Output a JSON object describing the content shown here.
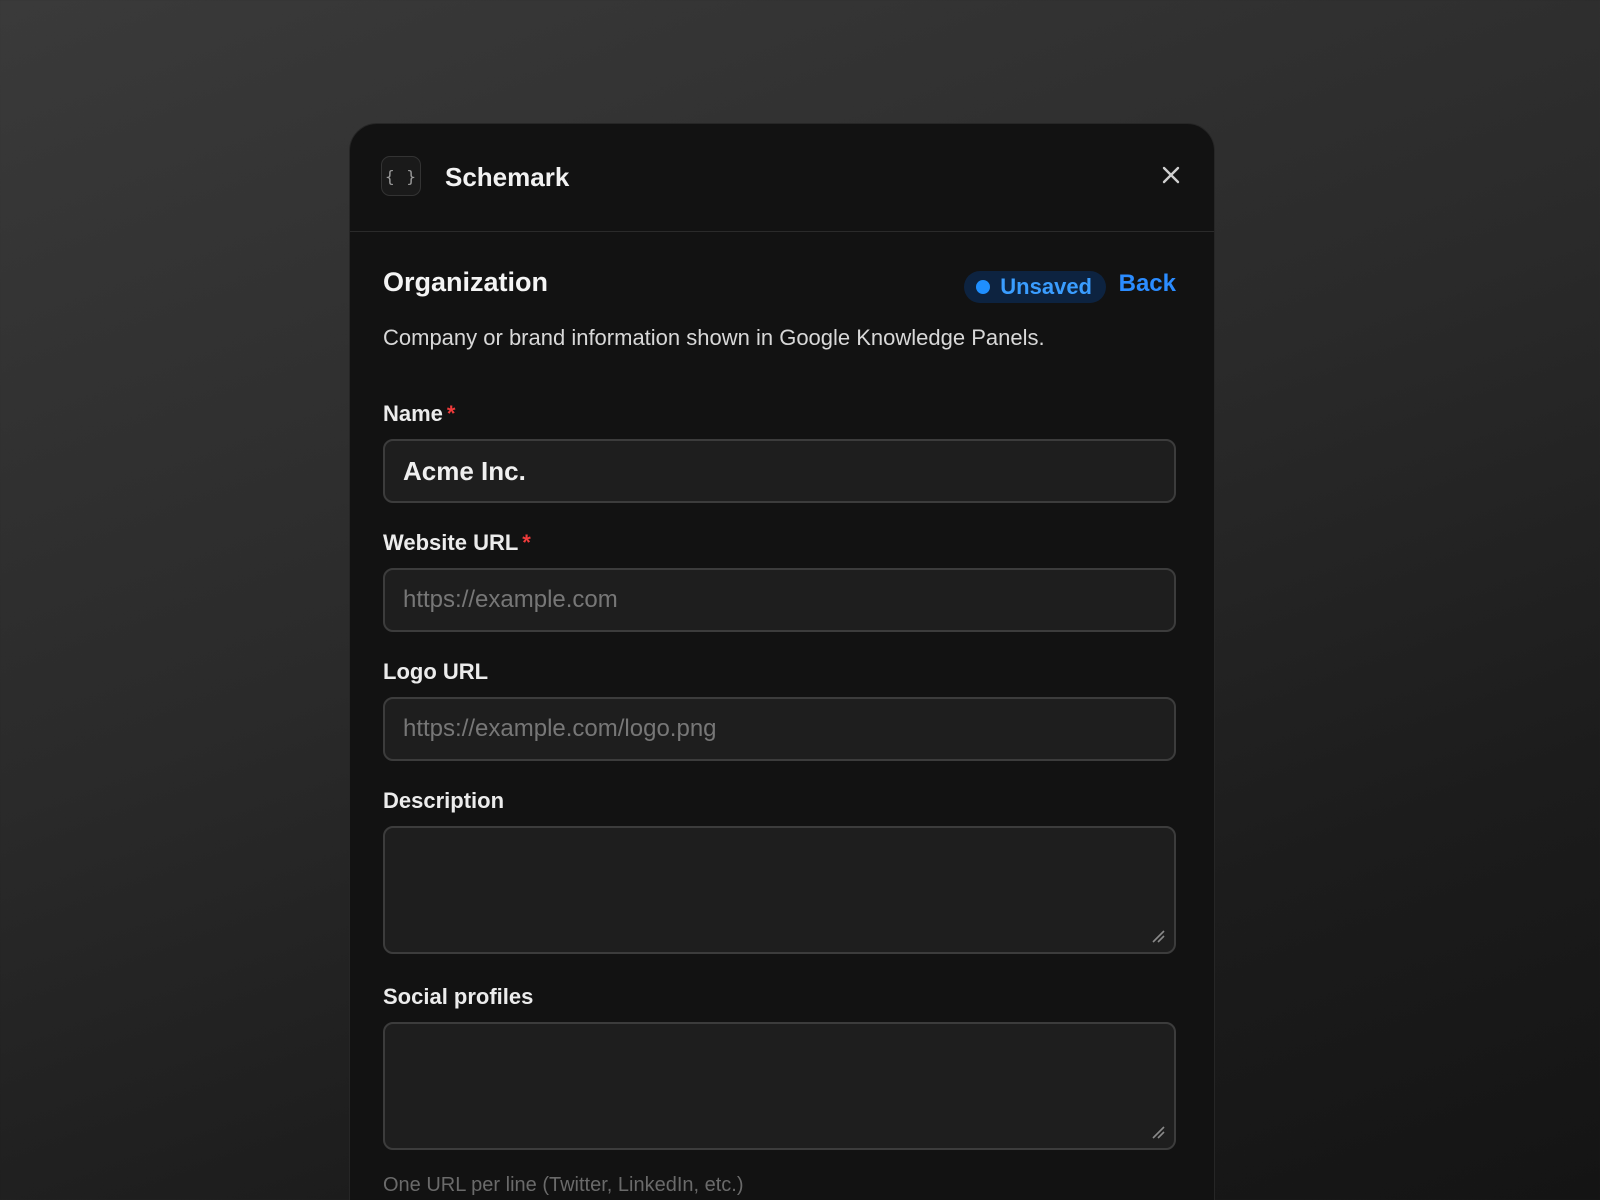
{
  "app": {
    "icon": "curly-braces-icon",
    "icon_glyph": "{ }",
    "title": "Schemark",
    "close_icon": "close-icon"
  },
  "section": {
    "title": "Organization",
    "status": "Unsaved",
    "back_label": "Back",
    "description": "Company or brand information shown in Google Knowledge Panels."
  },
  "fields": {
    "name": {
      "label": "Name",
      "required_mark": "*",
      "value": "Acme Inc.",
      "placeholder": ""
    },
    "website": {
      "label": "Website URL",
      "required_mark": "*",
      "value": "",
      "placeholder": "https://example.com"
    },
    "logo": {
      "label": "Logo URL",
      "value": "",
      "placeholder": "https://example.com/logo.png"
    },
    "description": {
      "label": "Description",
      "value": ""
    },
    "social": {
      "label": "Social profiles",
      "value": "",
      "hint": "One URL per line (Twitter, LinkedIn, etc.)"
    }
  },
  "colors": {
    "accent": "#2b8cff",
    "required": "#ef3b3b",
    "panel_bg": "#121212",
    "input_bg": "#1e1e1e"
  }
}
